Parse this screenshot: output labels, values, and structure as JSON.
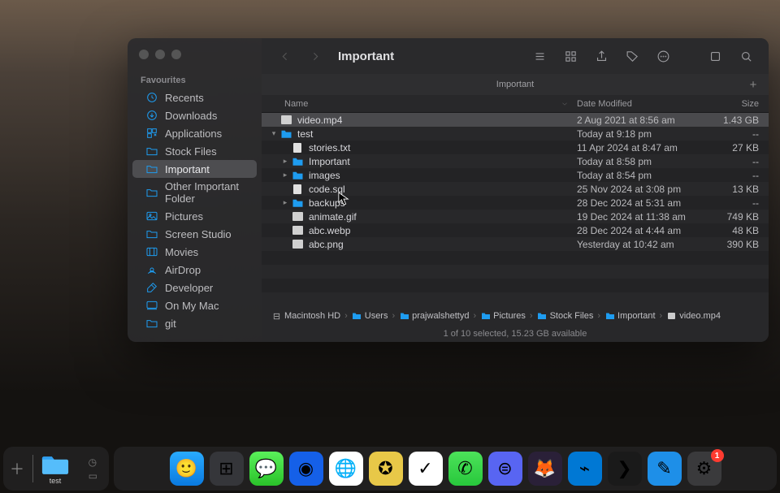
{
  "window": {
    "title": "Important",
    "tab": "Important"
  },
  "sidebar": {
    "section": "Favourites",
    "items": [
      {
        "label": "Recents",
        "icon": "clock"
      },
      {
        "label": "Downloads",
        "icon": "download"
      },
      {
        "label": "Applications",
        "icon": "apps"
      },
      {
        "label": "Stock Files",
        "icon": "folder"
      },
      {
        "label": "Important",
        "icon": "folder",
        "active": true
      },
      {
        "label": "Other Important Folder",
        "icon": "folder"
      },
      {
        "label": "Pictures",
        "icon": "picture"
      },
      {
        "label": "Screen Studio",
        "icon": "folder"
      },
      {
        "label": "Movies",
        "icon": "movie"
      },
      {
        "label": "AirDrop",
        "icon": "airdrop"
      },
      {
        "label": "Developer",
        "icon": "hammer"
      },
      {
        "label": "On My Mac",
        "icon": "mac"
      },
      {
        "label": "git",
        "icon": "folder"
      }
    ]
  },
  "columns": {
    "name": "Name",
    "date": "Date Modified",
    "size": "Size"
  },
  "files": [
    {
      "name": "video.mp4",
      "date": "2 Aug 2021 at 8:56 am",
      "size": "1.43 GB",
      "kind": "media",
      "depth": 0,
      "sel": true
    },
    {
      "name": "test",
      "date": "Today at 9:18 pm",
      "size": "--",
      "kind": "folder",
      "depth": 0,
      "disc": "open"
    },
    {
      "name": "stories.txt",
      "date": "11 Apr 2024 at 8:47 am",
      "size": "27 KB",
      "kind": "doc",
      "depth": 1
    },
    {
      "name": "Important",
      "date": "Today at 8:58 pm",
      "size": "--",
      "kind": "folder",
      "depth": 1,
      "disc": "closed"
    },
    {
      "name": "images",
      "date": "Today at 8:54 pm",
      "size": "--",
      "kind": "folder",
      "depth": 1,
      "disc": "closed"
    },
    {
      "name": "code.sql",
      "date": "25 Nov 2024 at 3:08 pm",
      "size": "13 KB",
      "kind": "doc",
      "depth": 1
    },
    {
      "name": "backups",
      "date": "28 Dec 2024 at 5:31 am",
      "size": "--",
      "kind": "folder",
      "depth": 1,
      "disc": "closed"
    },
    {
      "name": "animate.gif",
      "date": "19 Dec 2024 at 11:38 am",
      "size": "749 KB",
      "kind": "media",
      "depth": 1
    },
    {
      "name": "abc.webp",
      "date": "28 Dec 2024 at 4:44 am",
      "size": "48 KB",
      "kind": "media",
      "depth": 1
    },
    {
      "name": "abc.png",
      "date": "Yesterday at 10:42 am",
      "size": "390 KB",
      "kind": "media",
      "depth": 1
    }
  ],
  "path": [
    "Macintosh HD",
    "Users",
    "prajwalshettyd",
    "Pictures",
    "Stock Files",
    "Important",
    "video.mp4"
  ],
  "status": "1 of 10 selected, 15.23 GB available",
  "dock": {
    "stack_label": "test",
    "apps": [
      {
        "name": "Finder",
        "bg": "linear-gradient(180deg,#29abff,#0a7ae0)",
        "emoji": "🙂"
      },
      {
        "name": "Launchpad",
        "bg": "#35363a",
        "emoji": "⊞"
      },
      {
        "name": "Messages",
        "bg": "linear-gradient(180deg,#5af05a,#2ac22a)",
        "emoji": "💬"
      },
      {
        "name": "App",
        "bg": "#1560e8",
        "emoji": "◉"
      },
      {
        "name": "Chrome",
        "bg": "#fff",
        "emoji": "🌐"
      },
      {
        "name": "App2",
        "bg": "#e8c848",
        "emoji": "✪"
      },
      {
        "name": "Notes",
        "bg": "#fff",
        "emoji": "✓"
      },
      {
        "name": "WhatsApp",
        "bg": "linear-gradient(180deg,#4ce25a,#28c83c)",
        "emoji": "✆"
      },
      {
        "name": "Discord",
        "bg": "#5865f2",
        "emoji": "⊜"
      },
      {
        "name": "Firefox",
        "bg": "#2a2038",
        "emoji": "🦊"
      },
      {
        "name": "VSCode",
        "bg": "#0078d4",
        "emoji": "⌁"
      },
      {
        "name": "Terminal",
        "bg": "#1a1a1a",
        "emoji": "❯"
      },
      {
        "name": "Xcode",
        "bg": "#1e8fe8",
        "emoji": "✎"
      },
      {
        "name": "Settings",
        "bg": "#3a3a3c",
        "emoji": "⚙",
        "badge": "1"
      }
    ]
  }
}
